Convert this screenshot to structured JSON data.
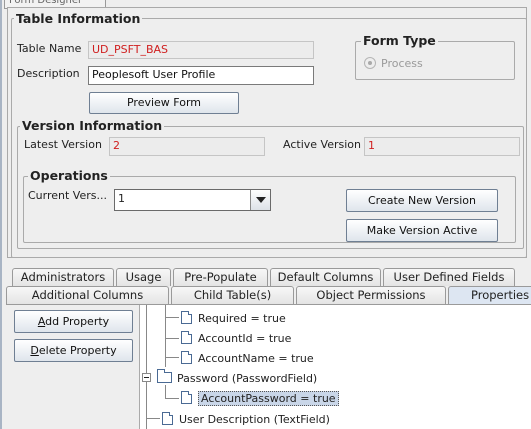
{
  "window": {
    "tab_title": "Form Designer"
  },
  "table_info": {
    "legend": "Table Information",
    "table_name_label": "Table Name",
    "table_name_value": "UD_PSFT_BAS",
    "description_label": "Description",
    "description_value": "Peoplesoft User Profile",
    "preview_button": "Preview Form"
  },
  "form_type": {
    "legend": "Form Type",
    "option": "Process"
  },
  "version_info": {
    "legend": "Version Information",
    "latest_label": "Latest Version",
    "latest_value": "2",
    "active_label": "Active Version",
    "active_value": "1"
  },
  "operations": {
    "legend": "Operations",
    "current_label": "Current Vers...",
    "current_value": "1",
    "create_button": "Create New Version",
    "activate_button": "Make Version Active"
  },
  "tabs_row1": [
    "Administrators",
    "Usage",
    "Pre-Populate",
    "Default Columns",
    "User Defined Fields"
  ],
  "tabs_row2": [
    "Additional Columns",
    "Child Table(s)",
    "Object Permissions",
    "Properties"
  ],
  "properties_panel": {
    "add_button": "Add Property",
    "delete_button": "Delete Property"
  },
  "tree": {
    "nodes": [
      "Required = true",
      "AccountId = true",
      "AccountName = true",
      "Password (PasswordField)",
      "AccountPassword = true",
      "User Description (TextField)"
    ]
  }
}
